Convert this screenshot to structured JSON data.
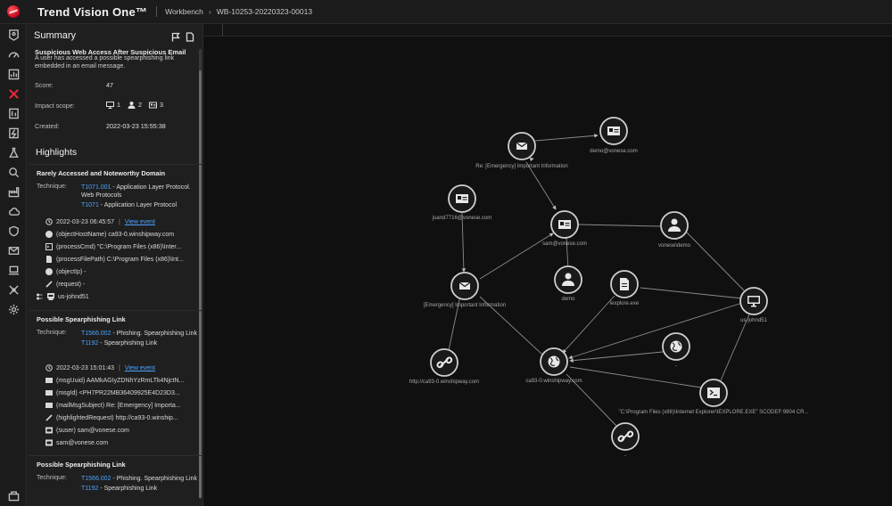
{
  "app": {
    "title": "Trend Vision One™",
    "breadcrumb": [
      "Workbench",
      "WB-10253-20220323-00013"
    ],
    "breadcrumb_sep": "›"
  },
  "nav": {
    "items": [
      {
        "icon": "map-pin-icon"
      },
      {
        "icon": "gauge-icon"
      },
      {
        "icon": "chart-icon"
      },
      {
        "icon": "xdr-x-icon",
        "active": true
      },
      {
        "icon": "report-icon"
      },
      {
        "icon": "bolt-icon"
      },
      {
        "icon": "lab-icon"
      },
      {
        "icon": "search-icon"
      },
      {
        "icon": "factory-icon"
      },
      {
        "icon": "cloud-icon"
      },
      {
        "icon": "shield-icon"
      },
      {
        "icon": "mail-icon"
      },
      {
        "icon": "laptop-icon"
      },
      {
        "icon": "network-icon"
      },
      {
        "icon": "gear-icon"
      },
      {
        "icon": "marketplace-icon"
      }
    ],
    "accent": "#e8283c"
  },
  "summary": {
    "heading": "Summary",
    "title": "Suspicious Web Access After Suspicious Email",
    "description": "A user has accessed a possible spearphishing link embedded in an email message.",
    "score_label": "Score:",
    "score_value": "47",
    "impact_label": "Impact scope:",
    "impact": {
      "desktops": "1",
      "users": "2",
      "accounts": "3"
    },
    "created_label": "Created:",
    "created_value": "2022-03-23 15:55:38"
  },
  "highlights": {
    "heading": "Highlights",
    "cards": [
      {
        "title": "Rarely Accessed and Noteworthy Domain",
        "technique_label": "Technique:",
        "techniques": [
          {
            "id": "T1071.001",
            "name": " - Application Layer Protocol. Web Protocols"
          },
          {
            "id": "T1071",
            "name": " - Application Layer Protocol"
          }
        ],
        "time": "2022-03-23 06:45:57",
        "view_event": "View event",
        "rows": [
          {
            "icon": "globe-icon",
            "text": "(objectHostName) ca93-0.winshipway.com"
          },
          {
            "icon": "terminal-icon",
            "text": "(processCmd) \"C:\\Program Files (x86)\\Inter..."
          },
          {
            "icon": "file-icon",
            "text": "(processFilePath) C:\\Program Files (x86)\\Int..."
          },
          {
            "icon": "globe-icon",
            "text": "(objectIp) -"
          },
          {
            "icon": "link-icon",
            "text": "(request) -"
          }
        ],
        "host": "us-johnd51"
      },
      {
        "title": "Possible Spearphishing Link",
        "technique_label": "Technique:",
        "techniques": [
          {
            "id": "T1566.002",
            "name": " - Phishing. Spearphishing Link"
          },
          {
            "id": "T1192",
            "name": " - Spearphishing Link"
          }
        ],
        "time": "2022-03-23 15:01:43",
        "view_event": "View event",
        "rows": [
          {
            "icon": "mail-icon",
            "text": "(msgUuid) AAMkAGIyZDNhYzRmLTk4NjctN..."
          },
          {
            "icon": "mail-icon",
            "text": "(msgId) <PH7PR22MB36409925E4D23D3..."
          },
          {
            "icon": "mail-icon",
            "text": "(mailMsgSubject) Re: [Emergency] Importa..."
          },
          {
            "icon": "link-icon",
            "text": "(highlightedRequest) http://ca93-0.winship..."
          },
          {
            "icon": "account-icon",
            "text": "(suser) sam@vonese.com"
          },
          {
            "icon": "account-icon",
            "text": "sam@vonese.com"
          }
        ]
      },
      {
        "title": "Possible Spearphishing Link",
        "technique_label": "Technique:",
        "techniques": [
          {
            "id": "T1566.002",
            "name": " - Phishing. Spearphishing Link"
          },
          {
            "id": "T1192",
            "name": " - Spearphishing Link"
          }
        ]
      }
    ]
  },
  "graph": {
    "nodes": {
      "email_re": {
        "icon": "mail-icon",
        "label": "Re: [Emergency] Important Information"
      },
      "demo_account": {
        "icon": "account-icon",
        "label": "demo@vonese.com"
      },
      "juand_account": {
        "icon": "account-icon",
        "label": "juand7716@vonese.com"
      },
      "sam_account": {
        "icon": "account-icon",
        "label": "sam@vonese.com"
      },
      "vonese_user": {
        "icon": "user-icon",
        "label": "vonese\\demo"
      },
      "demo_user": {
        "icon": "user-icon",
        "label": "demo"
      },
      "email_emerg": {
        "icon": "mail-icon",
        "label": "[Emergency] Important Information"
      },
      "iexplore": {
        "icon": "file-icon",
        "label": "iexplore.exe"
      },
      "host": {
        "icon": "desktop-icon",
        "label": "us-johnd51"
      },
      "url": {
        "icon": "link-icon",
        "label": "http://ca93-0.winshipway.com"
      },
      "domain": {
        "icon": "globe-icon",
        "label": "ca93-0.winshipway.com"
      },
      "ip": {
        "icon": "globe-icon",
        "label": "-"
      },
      "cmd": {
        "icon": "terminal-icon",
        "label": "\"C:\\Program Files (x86)\\Internet Explorer\\IEXPLORE.EXE\" SCODEF:9904 CR..."
      },
      "url2": {
        "icon": "link-icon",
        "label": "-"
      }
    }
  }
}
